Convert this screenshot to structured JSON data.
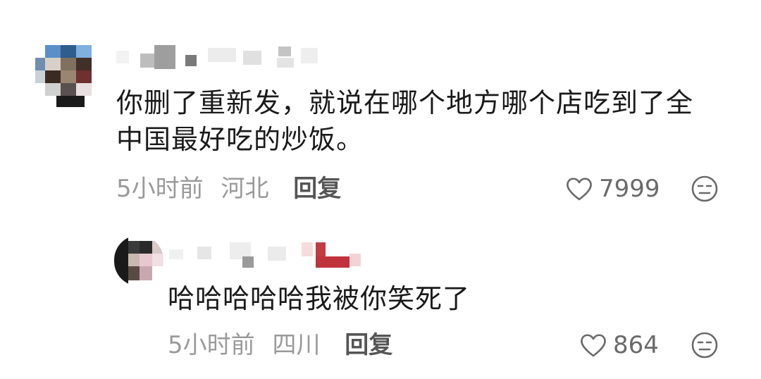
{
  "comments": [
    {
      "text": "你删了重新发，就说在哪个地方哪个店吃到了全\n中国最好吃的炒饭。",
      "time": "5小时前",
      "region": "河北",
      "reply_label": "回复",
      "likes": "7999",
      "icons": {
        "like": "heart-outline-icon",
        "reaction": "unamused-face-icon"
      }
    },
    {
      "text": "哈哈哈哈哈我被你笑死了",
      "time": "5小时前",
      "region": "四川",
      "reply_label": "回复",
      "likes": "864",
      "icons": {
        "like": "heart-outline-icon",
        "reaction": "unamused-face-icon"
      }
    }
  ],
  "colors": {
    "text": "#1a1a1a",
    "meta": "#9a9a9a",
    "reply": "#555555",
    "icon": "#6a6a6a"
  }
}
